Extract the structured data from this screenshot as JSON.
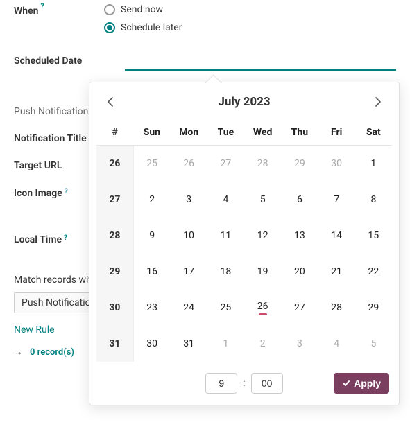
{
  "form": {
    "when_label": "When",
    "send_now": "Send now",
    "schedule_later": "Schedule later",
    "scheduled_date_label": "Scheduled Date",
    "scheduled_date_value": "",
    "section_push": "Push Notification",
    "notification_title": "Notification Title",
    "target_url": "Target URL",
    "icon_image": "Icon Image",
    "local_time": "Local Time",
    "match_records": "Match records with",
    "filter_pill": "Push Notification",
    "new_rule": "New Rule",
    "records_text": "0 record(s)"
  },
  "datepicker": {
    "title": "July 2023",
    "weeknum_header": "#",
    "dow": [
      "Sun",
      "Mon",
      "Tue",
      "Wed",
      "Thu",
      "Fri",
      "Sat"
    ],
    "rows": [
      {
        "wn": "26",
        "days": [
          {
            "d": "25",
            "o": true
          },
          {
            "d": "26",
            "o": true
          },
          {
            "d": "27",
            "o": true
          },
          {
            "d": "28",
            "o": true
          },
          {
            "d": "29",
            "o": true
          },
          {
            "d": "30",
            "o": true
          },
          {
            "d": "1"
          }
        ]
      },
      {
        "wn": "27",
        "days": [
          {
            "d": "2"
          },
          {
            "d": "3"
          },
          {
            "d": "4"
          },
          {
            "d": "5"
          },
          {
            "d": "6"
          },
          {
            "d": "7"
          },
          {
            "d": "8"
          }
        ]
      },
      {
        "wn": "28",
        "days": [
          {
            "d": "9"
          },
          {
            "d": "10"
          },
          {
            "d": "11"
          },
          {
            "d": "12"
          },
          {
            "d": "13"
          },
          {
            "d": "14"
          },
          {
            "d": "15"
          }
        ]
      },
      {
        "wn": "29",
        "days": [
          {
            "d": "16"
          },
          {
            "d": "17"
          },
          {
            "d": "18"
          },
          {
            "d": "19"
          },
          {
            "d": "20"
          },
          {
            "d": "21"
          },
          {
            "d": "22"
          }
        ]
      },
      {
        "wn": "30",
        "days": [
          {
            "d": "23"
          },
          {
            "d": "24"
          },
          {
            "d": "25"
          },
          {
            "d": "26",
            "today": true
          },
          {
            "d": "27"
          },
          {
            "d": "28"
          },
          {
            "d": "29"
          }
        ]
      },
      {
        "wn": "31",
        "days": [
          {
            "d": "30"
          },
          {
            "d": "31"
          },
          {
            "d": "1",
            "o": true
          },
          {
            "d": "2",
            "o": true
          },
          {
            "d": "3",
            "o": true
          },
          {
            "d": "4",
            "o": true
          },
          {
            "d": "5",
            "o": true
          }
        ]
      }
    ],
    "hour": "9",
    "minute": "00",
    "apply": "Apply"
  }
}
